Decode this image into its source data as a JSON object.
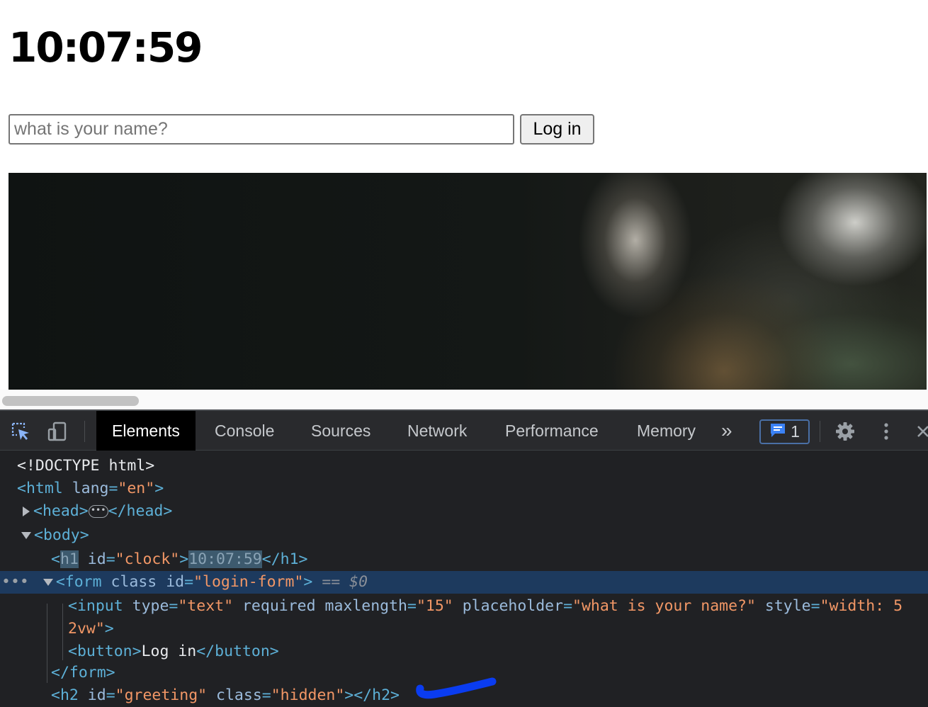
{
  "page": {
    "clock": "10:07:59",
    "input_placeholder": "what is your name?",
    "login_button": "Log in"
  },
  "devtools": {
    "tabs": [
      "Elements",
      "Console",
      "Sources",
      "Network",
      "Performance",
      "Memory"
    ],
    "active_tab": "Elements",
    "more_tabs": "»",
    "issues_count": "1",
    "icons": [
      "inspect-element-icon",
      "device-toolbar-icon",
      "issues-icon",
      "gear-icon",
      "kebab-menu-icon",
      "close-icon"
    ],
    "dom": {
      "doctype": "<!DOCTYPE html>",
      "html_open": "<html",
      "html_attr": "lang",
      "html_attr_val": "\"en\"",
      "head_open": "<head>",
      "head_close": "</head>",
      "body_open": "<body>",
      "h1_tag": "h1",
      "h1_attr": "id",
      "h1_attr_val": "\"clock\"",
      "h1_text": "10:07:59",
      "h1_close": "</h1>",
      "form_open": "<form",
      "form_attr1": "class",
      "form_attr2": "id",
      "form_attr2_val": "\"login-form\"",
      "form_marker": "== $0",
      "input_open": "<input",
      "input_attr_type": "type",
      "input_attr_type_val": "\"text\"",
      "input_attr_required": "required",
      "input_attr_maxlength": "maxlength",
      "input_attr_maxlength_val": "\"15\"",
      "input_attr_placeholder": "placeholder",
      "input_attr_placeholder_val": "\"what is your name?\"",
      "input_attr_style": "style",
      "input_attr_style_val_1": "\"width: 5",
      "input_attr_style_val_2": "2vw\"",
      "button_open": "<button>",
      "button_text": "Log in",
      "button_close": "</button>",
      "form_close": "</form>",
      "h2_open": "<h2",
      "h2_attr_id": "id",
      "h2_attr_id_val": "\"greeting\"",
      "h2_attr_class": "class",
      "h2_attr_class_val": "\"hidden\"",
      "h2_close": "></h2>"
    },
    "annotation_color": "#0a3cf0"
  }
}
